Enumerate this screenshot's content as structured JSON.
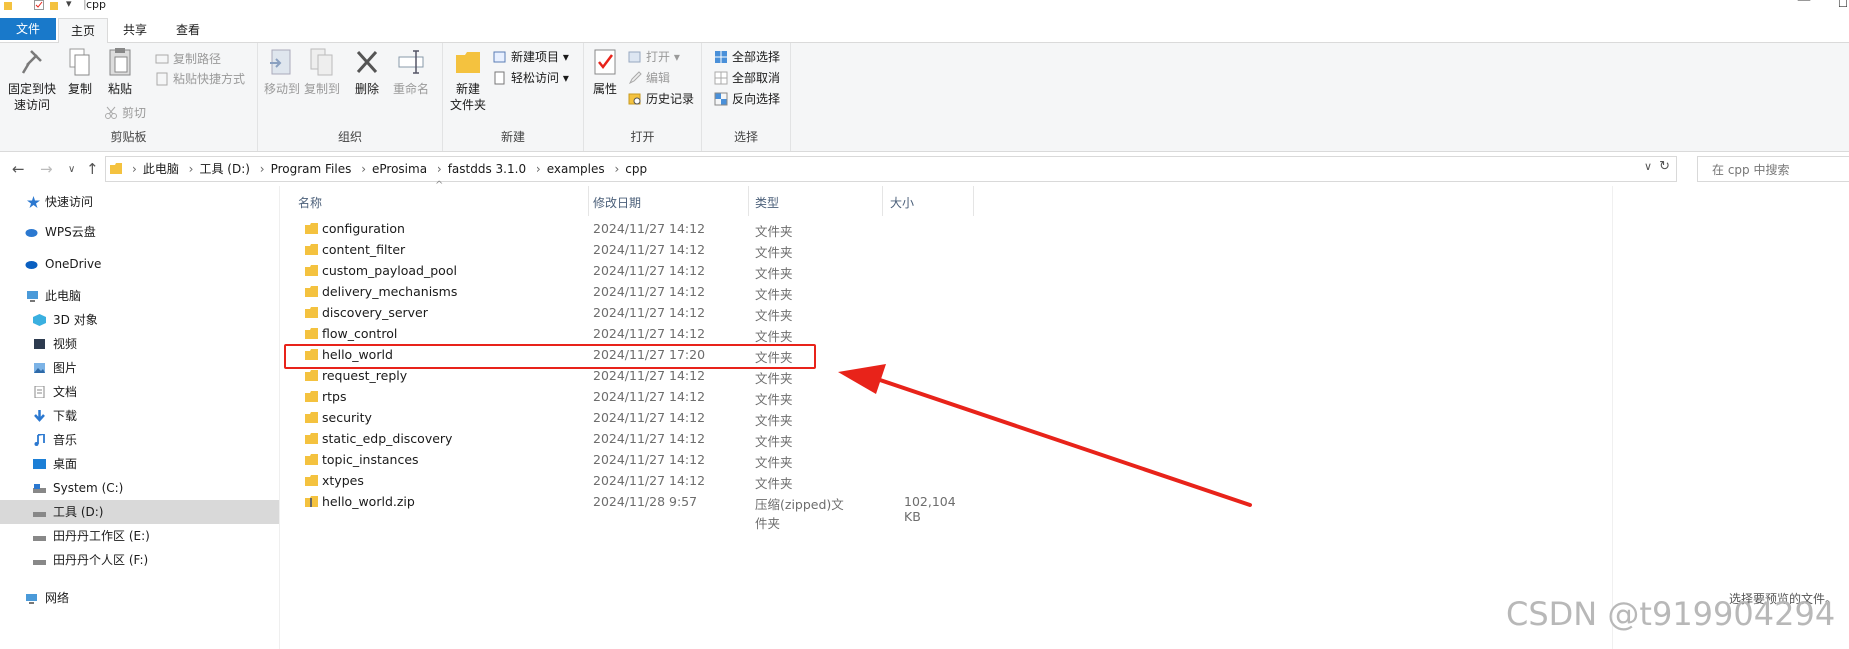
{
  "window": {
    "title": "cpp"
  },
  "ribbon_tabs": [
    {
      "label": "文件"
    },
    {
      "label": "主页"
    },
    {
      "label": "共享"
    },
    {
      "label": "查看"
    }
  ],
  "ribbon": {
    "clipboard": {
      "pin_label": "固定到快速访问",
      "pin_l1": "固定到快",
      "pin_l2": "速访问",
      "copy": "复制",
      "paste": "粘贴",
      "copy_path": "复制路径",
      "paste_shortcut": "粘贴快捷方式",
      "cut": "剪切",
      "group": "剪贴板"
    },
    "organize": {
      "move_to": "移动到",
      "copy_to": "复制到",
      "delete": "删除",
      "rename": "重命名",
      "group": "组织"
    },
    "new": {
      "new_folder_l1": "新建",
      "new_folder_l2": "文件夹",
      "new_item": "新建项目",
      "easy_access": "轻松访问",
      "group": "新建"
    },
    "open": {
      "properties": "属性",
      "open": "打开",
      "edit": "编辑",
      "history": "历史记录",
      "group": "打开"
    },
    "select": {
      "select_all": "全部选择",
      "select_none": "全部取消",
      "invert": "反向选择",
      "group": "选择"
    }
  },
  "address": {
    "crumbs": [
      "此电脑",
      "工具 (D:)",
      "Program Files",
      "eProsima",
      "fastdds 3.1.0",
      "examples",
      "cpp"
    ],
    "search_placeholder": "在 cpp 中搜索"
  },
  "nav": [
    {
      "label": "快速访问",
      "icon": "star-icon"
    },
    {
      "label": "WPS云盘",
      "icon": "cloud-icon"
    },
    {
      "label": "OneDrive",
      "icon": "cloud-icon"
    },
    {
      "label": "此电脑",
      "icon": "computer-icon"
    },
    {
      "label": "3D 对象",
      "icon": "cube-icon"
    },
    {
      "label": "视频",
      "icon": "video-icon"
    },
    {
      "label": "图片",
      "icon": "picture-icon"
    },
    {
      "label": "文档",
      "icon": "document-icon"
    },
    {
      "label": "下载",
      "icon": "download-icon"
    },
    {
      "label": "音乐",
      "icon": "music-icon"
    },
    {
      "label": "桌面",
      "icon": "desktop-icon"
    },
    {
      "label": "System (C:)",
      "icon": "drive-icon"
    },
    {
      "label": "工具 (D:)",
      "icon": "drive-icon"
    },
    {
      "label": "田丹丹工作区 (E:)",
      "icon": "drive-icon"
    },
    {
      "label": "田丹丹个人区 (F:)",
      "icon": "drive-icon"
    },
    {
      "label": "网络",
      "icon": "network-icon"
    }
  ],
  "columns": {
    "name": "名称",
    "date": "修改日期",
    "type": "类型",
    "size": "大小"
  },
  "files": [
    {
      "name": "configuration",
      "date": "2024/11/27 14:12",
      "type": "文件夹",
      "size": ""
    },
    {
      "name": "content_filter",
      "date": "2024/11/27 14:12",
      "type": "文件夹",
      "size": ""
    },
    {
      "name": "custom_payload_pool",
      "date": "2024/11/27 14:12",
      "type": "文件夹",
      "size": ""
    },
    {
      "name": "delivery_mechanisms",
      "date": "2024/11/27 14:12",
      "type": "文件夹",
      "size": ""
    },
    {
      "name": "discovery_server",
      "date": "2024/11/27 14:12",
      "type": "文件夹",
      "size": ""
    },
    {
      "name": "flow_control",
      "date": "2024/11/27 14:12",
      "type": "文件夹",
      "size": ""
    },
    {
      "name": "hello_world",
      "date": "2024/11/27 17:20",
      "type": "文件夹",
      "size": ""
    },
    {
      "name": "request_reply",
      "date": "2024/11/27 14:12",
      "type": "文件夹",
      "size": ""
    },
    {
      "name": "rtps",
      "date": "2024/11/27 14:12",
      "type": "文件夹",
      "size": ""
    },
    {
      "name": "security",
      "date": "2024/11/27 14:12",
      "type": "文件夹",
      "size": ""
    },
    {
      "name": "static_edp_discovery",
      "date": "2024/11/27 14:12",
      "type": "文件夹",
      "size": ""
    },
    {
      "name": "topic_instances",
      "date": "2024/11/27 14:12",
      "type": "文件夹",
      "size": ""
    },
    {
      "name": "xtypes",
      "date": "2024/11/27 14:12",
      "type": "文件夹",
      "size": ""
    },
    {
      "name": "hello_world.zip",
      "date": "2024/11/28 9:57",
      "type": "压缩(zipped)文件夹",
      "size": "102,104 KB"
    }
  ],
  "preview_text": "选择要预览的文件。",
  "watermark": "CSDN @t919904294",
  "colors": {
    "accent": "#1979ca",
    "highlight": "#e8231a",
    "folder": "#f4c23f"
  }
}
